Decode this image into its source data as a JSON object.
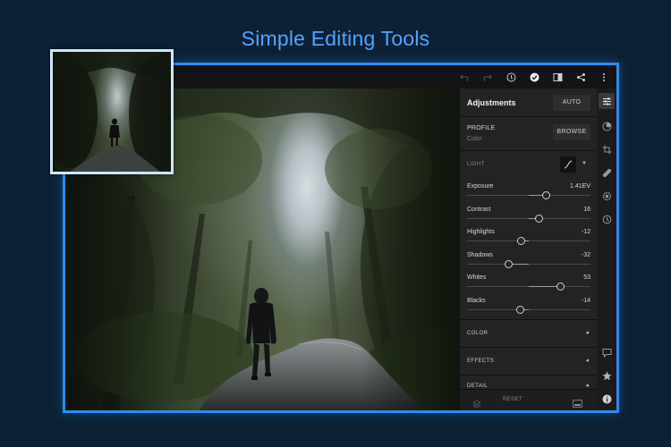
{
  "headline": "Simple Editing Tools",
  "panel": {
    "title": "Adjustments",
    "auto_label": "AUTO",
    "profile_label": "PROFILE",
    "profile_value": "Color",
    "browse_label": "BROWSE",
    "light_label": "LIGHT",
    "sliders": [
      {
        "label": "Exposure",
        "value": "1.41EV",
        "level": 0.64
      },
      {
        "label": "Contrast",
        "value": "16",
        "level": 0.58
      },
      {
        "label": "Highlights",
        "value": "-12",
        "level": 0.44
      },
      {
        "label": "Shadows",
        "value": "-32",
        "level": 0.34
      },
      {
        "label": "Whites",
        "value": "53",
        "level": 0.76
      },
      {
        "label": "Blacks",
        "value": "-14",
        "level": 0.43
      }
    ],
    "sections": [
      {
        "label": "COLOR"
      },
      {
        "label": "EFFECTS"
      },
      {
        "label": "DETAIL"
      }
    ],
    "reset_label": "RESET"
  },
  "toolbar_icons": [
    "undo-icon",
    "redo-icon",
    "info-icon",
    "check-icon",
    "compare-icon",
    "share-icon",
    "more-icon"
  ],
  "rail_icons": [
    "adjustments-icon",
    "color-mix-icon",
    "crop-rotate-icon",
    "healing-brush-icon",
    "mask-icon",
    "history-icon",
    "comment-icon",
    "star-icon",
    "info-icon"
  ],
  "colors": {
    "accent": "#2d8cf0",
    "background": "#0c2135",
    "panel": "#232323"
  }
}
